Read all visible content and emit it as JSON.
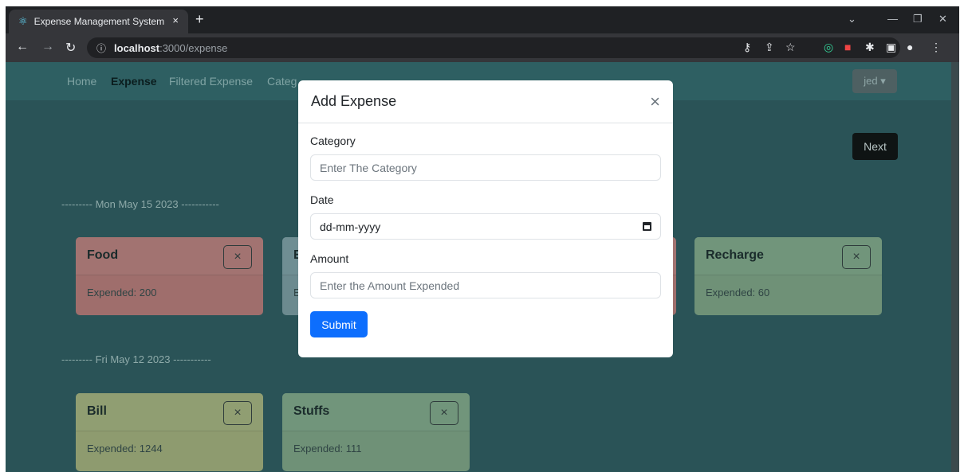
{
  "browser": {
    "tab_title": "Expense Management System",
    "tab_close": "×",
    "new_tab": "+",
    "url_host": "localhost",
    "url_path": ":3000/expense"
  },
  "nav": {
    "links": [
      "Home",
      "Expense",
      "Filtered Expense",
      "Categ"
    ],
    "user_label": "jed ▾"
  },
  "next_label": "Next",
  "groups": [
    {
      "date_label": "--------- Mon May 15 2023 -----------",
      "cards": [
        {
          "name": "Food",
          "amount": "Expended: 200"
        },
        {
          "name": "E",
          "amount": "E"
        },
        {
          "name": "Recharge",
          "amount": "Expended: 60"
        }
      ]
    },
    {
      "date_label": "--------- Fri May 12 2023 -----------",
      "cards": [
        {
          "name": "Bill",
          "amount": "Expended: 1244"
        },
        {
          "name": "Stuffs",
          "amount": "Expended: 111"
        }
      ]
    }
  ],
  "card_close": "×",
  "modal": {
    "title": "Add Expense",
    "close": "×",
    "category_label": "Category",
    "category_placeholder": "Enter The Category",
    "date_label": "Date",
    "date_placeholder": "dd-mm-yyyy",
    "amount_label": "Amount",
    "amount_placeholder": "Enter the Amount Expended",
    "submit_label": "Submit"
  },
  "icons": [
    "react-icon",
    "back-arrow-icon",
    "forward-arrow-icon",
    "reload-icon",
    "info-icon",
    "key-icon",
    "share-icon",
    "star-icon",
    "extension-icon",
    "profile-icon",
    "menu-icon",
    "calendar-icon",
    "close-icon"
  ]
}
